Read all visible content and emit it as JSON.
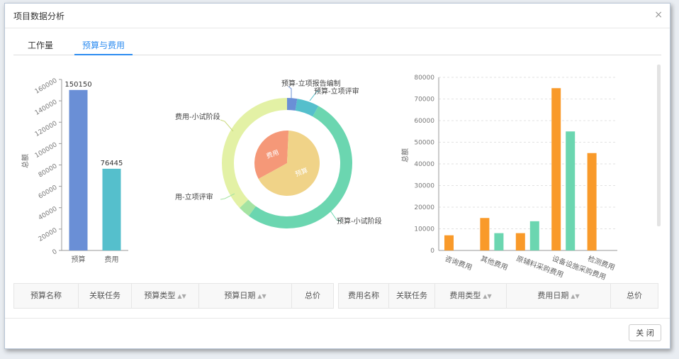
{
  "dialog": {
    "title": "项目数据分析",
    "close_icon": "×"
  },
  "tabs": [
    {
      "label": "工作量",
      "active": false
    },
    {
      "label": "预算与费用",
      "active": true
    }
  ],
  "chart_data": [
    {
      "type": "bar",
      "ylabel": "总额",
      "categories": [
        "预算",
        "费用"
      ],
      "values": [
        150150,
        76445
      ],
      "data_labels": [
        "150150",
        "76445"
      ],
      "colors": [
        "#6a8fd6",
        "#55bfcc"
      ],
      "ylim": [
        0,
        160000
      ],
      "yticks": [
        "0",
        "20000",
        "40000",
        "60000",
        "80000",
        "100000",
        "120000",
        "140000",
        "160000"
      ]
    },
    {
      "type": "pie",
      "inner": [
        {
          "name": "费用",
          "value": 76445,
          "color": "#f59878"
        },
        {
          "name": "预算",
          "value": 150150,
          "color": "#f0d388"
        }
      ],
      "outer": [
        {
          "name": "预算-立项报告编制",
          "share": 0.025,
          "color": "#6a8fd6"
        },
        {
          "name": "预算-立项评审",
          "share": 0.055,
          "color": "#55bfcc"
        },
        {
          "name": "预算-小试阶段",
          "share": 0.52,
          "color": "#6bd6b0"
        },
        {
          "name": "费用-立项评审",
          "share": 0.03,
          "color": "#a5e3a2"
        },
        {
          "name": "费用-小试阶段",
          "share": 0.37,
          "color": "#e3f1a5"
        }
      ],
      "labels": {
        "budget_report": "预算-立项报告编制",
        "budget_review": "预算-立项评审",
        "budget_trial": "预算-小试阶段",
        "cost_review": "用-立项评审",
        "cost_trial": "费用-小试阶段"
      }
    },
    {
      "type": "bar",
      "ylabel": "总额",
      "categories": [
        "咨询费用",
        "其他费用",
        "原辅料采购费用",
        "设备设施采购费用",
        "检测费用"
      ],
      "series": [
        {
          "values": [
            7000,
            15000,
            8000,
            75000,
            45000
          ],
          "color": "#f99a2a"
        },
        {
          "values": [
            null,
            8000,
            13500,
            55000,
            null
          ],
          "color": "#6bd6b0"
        }
      ],
      "ylim": [
        0,
        80000
      ],
      "yticks": [
        "0",
        "10000",
        "20000",
        "30000",
        "40000",
        "50000",
        "60000",
        "70000",
        "80000"
      ]
    }
  ],
  "budget_table": {
    "headers": [
      "预算名称",
      "关联任务",
      "预算类型",
      "预算日期",
      "总价"
    ],
    "sortable": [
      false,
      false,
      true,
      true,
      false
    ]
  },
  "cost_table": {
    "headers": [
      "费用名称",
      "关联任务",
      "费用类型",
      "费用日期",
      "总价"
    ],
    "sortable": [
      false,
      false,
      true,
      true,
      false
    ]
  },
  "footer": {
    "close_button": "关 闭"
  }
}
